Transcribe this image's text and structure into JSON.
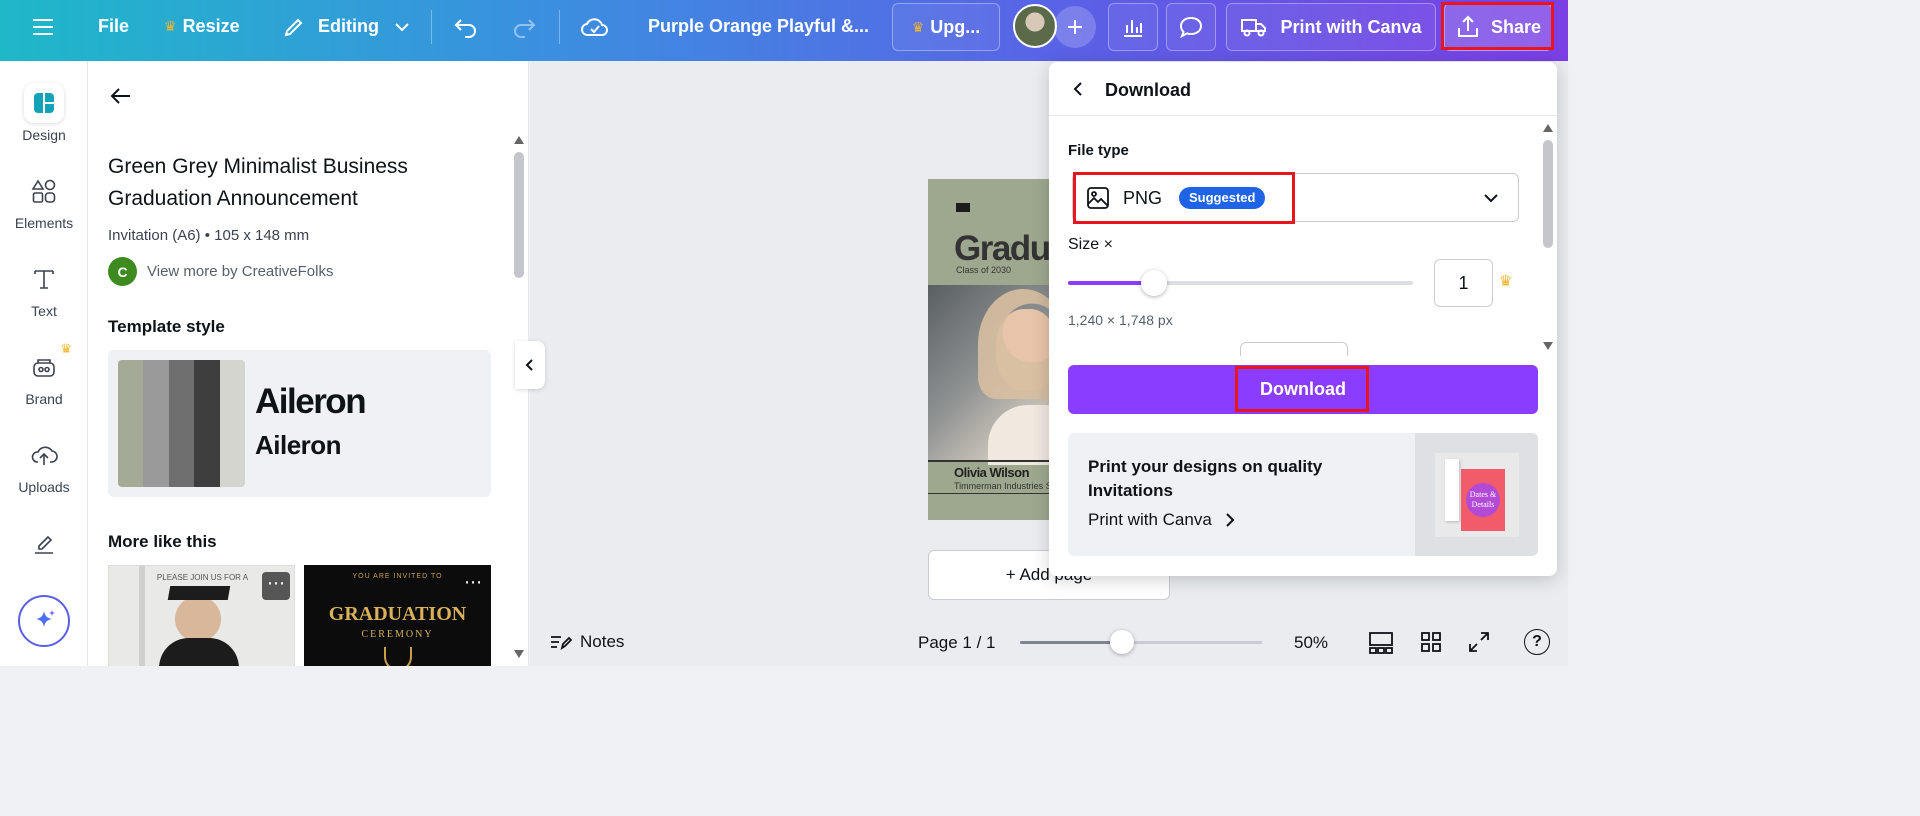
{
  "topbar": {
    "file": "File",
    "resize": "Resize",
    "editing": "Editing",
    "doc_title": "Purple Orange Playful &...",
    "upgrade": "Upg...",
    "print": "Print with Canva",
    "share": "Share"
  },
  "rail": {
    "design": "Design",
    "elements": "Elements",
    "text": "Text",
    "brand": "Brand",
    "uploads": "Uploads"
  },
  "panel": {
    "title_line1": "Green Grey Minimalist Business",
    "title_line2": "Graduation Announcement",
    "meta": "Invitation (A6) • 105 x 148 mm",
    "author_initial": "C",
    "author_link": "View more by CreativeFolks",
    "template_style": "Template style",
    "font_heading": "Aileron",
    "font_body": "Aileron",
    "more_like_this": "More like this",
    "thumb1_text": "PLEASE JOIN US FOR A",
    "thumb2_small": "YOU ARE INVITED TO",
    "thumb2_title": "GRADUATION",
    "thumb2_sub": "CEREMONY",
    "swatches": [
      "#a3aa95",
      "#9a9a9a",
      "#6f6f6f",
      "#3e3e3e",
      "#d5d5cf"
    ]
  },
  "canvas": {
    "card_title": "Gradu",
    "class_of": "Class of 2030",
    "name": "Olivia Wilson",
    "company": "Timmerman Industries S",
    "add_page": "+  Add page"
  },
  "bottombar": {
    "notes": "Notes",
    "page": "Page 1 / 1",
    "zoom": "50%",
    "zoom_level": 0.42
  },
  "download": {
    "title": "Download",
    "file_type_label": "File type",
    "file_type": "PNG",
    "suggested": "Suggested",
    "size_label": "Size ×",
    "size_value": "1",
    "size_level": 0.25,
    "dimensions": "1,240 × 1,748 px",
    "download_button": "Download",
    "promo_title_1": "Print your designs on quality",
    "promo_title_2": "Invitations",
    "promo_link": "Print with Canva",
    "promo_card_text": "Dates & Details"
  }
}
